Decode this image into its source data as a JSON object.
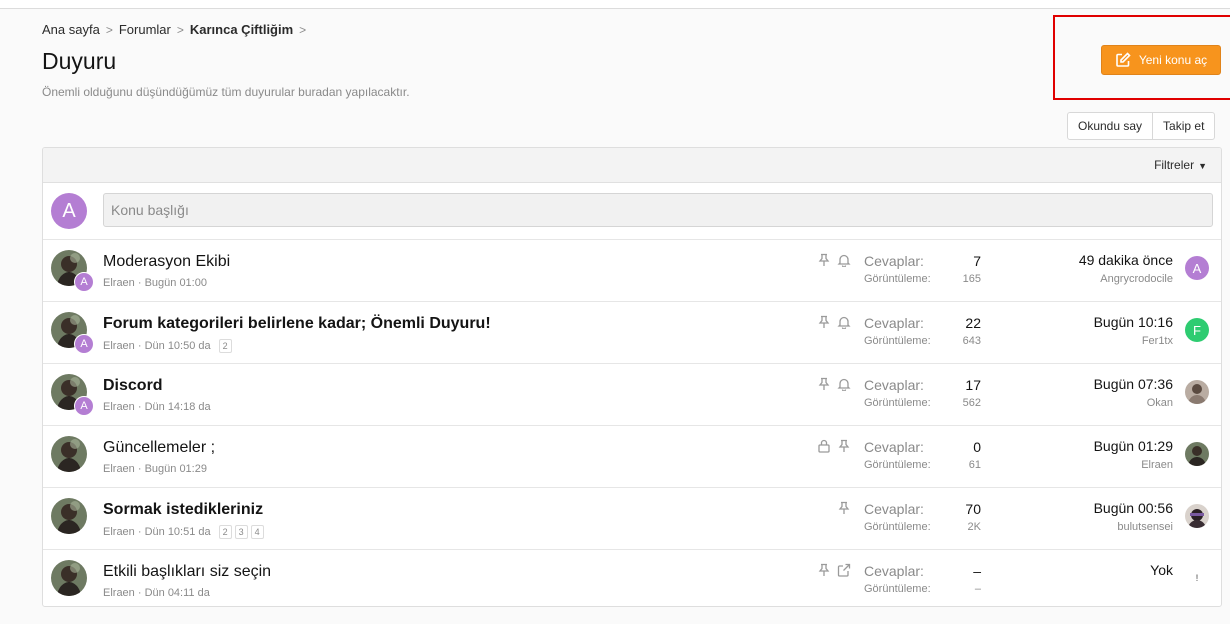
{
  "breadcrumb": {
    "items": [
      {
        "label": "Ana sayfa"
      },
      {
        "label": "Forumlar"
      },
      {
        "label": "Karınca Çiftliğim"
      }
    ],
    "separator": ">"
  },
  "header": {
    "title": "Duyuru",
    "description": "Önemli olduğunu düşündüğümüz tüm duyurular buradan yapılacaktır.",
    "new_thread_label": "Yeni konu aç"
  },
  "actions": {
    "mark_read": "Okundu say",
    "watch": "Takip et"
  },
  "filter": {
    "label": "Filtreler"
  },
  "quick_thread": {
    "avatar_letter": "A",
    "placeholder": "Konu başlığı"
  },
  "stats_labels": {
    "replies": "Cevaplar:",
    "views": "Görüntüleme:"
  },
  "threads": [
    {
      "title": "Moderasyon Ekibi",
      "author": "Elraen",
      "date": "Bugün 01:00",
      "replies": "7",
      "views": "165",
      "last_time": "49 dakika önce",
      "last_user": "Angrycrodocile",
      "last_avatar_letter": "A"
    },
    {
      "title": "Forum kategorileri belirlene kadar; Önemli Duyuru!",
      "author": "Elraen",
      "date": "Dün 10:50 da",
      "pages": [
        "2"
      ],
      "replies": "22",
      "views": "643",
      "last_time": "Bugün 10:16",
      "last_user": "Fer1tx",
      "last_avatar_letter": "F"
    },
    {
      "title": "Discord",
      "author": "Elraen",
      "date": "Dün 14:18 da",
      "replies": "17",
      "views": "562",
      "last_time": "Bugün 07:36",
      "last_user": "Okan"
    },
    {
      "title": "Güncellemeler ;",
      "author": "Elraen",
      "date": "Bugün 01:29",
      "replies": "0",
      "views": "61",
      "last_time": "Bugün 01:29",
      "last_user": "Elraen"
    },
    {
      "title": "Sormak istedikleriniz",
      "author": "Elraen",
      "date": "Dün 10:51 da",
      "pages": [
        "2",
        "3",
        "4"
      ],
      "replies": "70",
      "views": "2K",
      "last_time": "Bugün 00:56",
      "last_user": "bulutsensei"
    },
    {
      "title": "Etkili başlıkları siz seçin",
      "author": "Elraen",
      "date": "Dün 04:11 da",
      "replies": "–",
      "views": "–",
      "last_time": "Yok",
      "last_user": ""
    }
  ],
  "colors": {
    "accent": "#f7941d",
    "avatar_purple": "#b47ed3",
    "avatar_green": "#2ecc71",
    "highlight": "#e00000"
  }
}
